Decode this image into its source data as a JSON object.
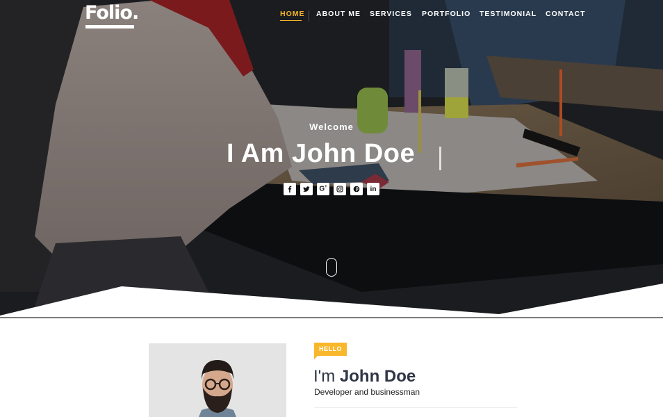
{
  "brand": {
    "logo_text": "Folio."
  },
  "nav": {
    "items": [
      {
        "label": "HOME",
        "active": true
      },
      {
        "label": "ABOUT ME",
        "active": false
      },
      {
        "label": "SERVICES",
        "active": false
      },
      {
        "label": "PORTFOLIO",
        "active": false
      },
      {
        "label": "TESTIMONIAL",
        "active": false
      },
      {
        "label": "CONTACT",
        "active": false
      }
    ]
  },
  "hero": {
    "kicker": "Welcome",
    "headline": "I Am John Doe",
    "social_icons": [
      {
        "name": "facebook-icon",
        "glyph": "f"
      },
      {
        "name": "twitter-icon",
        "glyph": "t"
      },
      {
        "name": "google-plus-icon",
        "glyph": "G+"
      },
      {
        "name": "instagram-icon",
        "glyph": "ig"
      },
      {
        "name": "pinterest-icon",
        "glyph": "p"
      },
      {
        "name": "linkedin-icon",
        "glyph": "in"
      }
    ],
    "scroll_icon": "mouse-scroll-icon"
  },
  "about": {
    "badge": "HELLO",
    "greeting_prefix": "I'm",
    "name": "John Doe",
    "role": "Developer and businessman"
  },
  "colors": {
    "accent": "#f5b529",
    "badge": "#f9b72b",
    "heading": "#2f3545"
  }
}
